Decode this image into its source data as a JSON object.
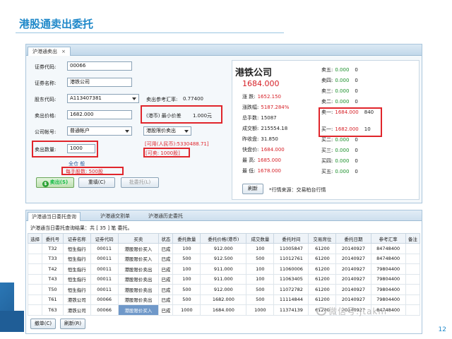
{
  "slide": {
    "title": "港股通卖出委托",
    "page": "12"
  },
  "top_tab": {
    "label": "沪港通卖出",
    "close": "×"
  },
  "form": {
    "code_label": "证券代码:",
    "code_value": "00066",
    "name_label": "证券名称:",
    "name_value": "港铁公司",
    "account_label": "股东代码:",
    "account_value": "A113407381",
    "rate_label": "卖出参考汇率:",
    "rate_value": "0.77400",
    "price_label": "卖出价格:",
    "price_value": "1682.000",
    "price_diff_label": "(港币) 最小价差",
    "price_diff_value": "1.000元",
    "mode_label": "交易方式:",
    "mode_value": "港股限价卖出",
    "company_label": "公司帐号:",
    "company_value": "普通帐户",
    "available_funds": "[可用(人民币):5330488.71]",
    "qty_label": "卖出数量:",
    "qty_value": "1000",
    "sellable": "[可卖: 1000股]",
    "lot_note": "全仓 般",
    "lot_size": "每手股数: 500股",
    "sell_button": "卖出(S)",
    "clear_button": "重填(C)",
    "batch_button": "批委托(L)"
  },
  "quote": {
    "name": "港铁公司",
    "price": "1684.000",
    "left_rows": [
      {
        "label": "涨  跌:",
        "value": "1652.150"
      },
      {
        "label": "涨跌幅:",
        "value": "5187.284%"
      },
      {
        "label": "总手数:",
        "value": "15087"
      },
      {
        "label": "成交额:",
        "value": "215554.18"
      },
      {
        "label": "昨收盘:",
        "value": "31.850"
      },
      {
        "label": "快盘价:",
        "value": "1684.000"
      },
      {
        "label": "最  高:",
        "value": "1685.000"
      },
      {
        "label": "最  低:",
        "value": "1678.000"
      }
    ],
    "sell_rows": [
      {
        "label": "卖五:",
        "price": "0.000",
        "vol": "0"
      },
      {
        "label": "卖四:",
        "price": "0.000",
        "vol": "0"
      },
      {
        "label": "卖三:",
        "price": "0.000",
        "vol": "0"
      },
      {
        "label": "卖二:",
        "price": "0.000",
        "vol": "0"
      },
      {
        "label": "卖一:",
        "price": "1684.000",
        "vol": "840"
      }
    ],
    "buy_rows": [
      {
        "label": "买一:",
        "price": "1682.000",
        "vol": "10"
      },
      {
        "label": "买二:",
        "price": "0.000",
        "vol": "0"
      },
      {
        "label": "买三:",
        "price": "0.000",
        "vol": "0"
      },
      {
        "label": "买四:",
        "price": "0.000",
        "vol": "0"
      },
      {
        "label": "买五:",
        "price": "0.000",
        "vol": "0"
      }
    ],
    "refresh_button": "刷新",
    "source": "*行情来源：交易柏台行情"
  },
  "lower": {
    "tabs": [
      "沪港通当日委托查询",
      "沪港通交割单",
      "沪港通历史委托"
    ],
    "query_info": "沪港通当日委托查询结果：共 [ 35 ] 笔 委托。",
    "columns": [
      "选择",
      "委托号",
      "证券名称",
      "证券代码",
      "买卖",
      "状态",
      "委托数量",
      "委托价格(港币)",
      "成交数量",
      "委托时间",
      "交易席位",
      "委托日期",
      "参考汇率",
      "备注"
    ],
    "rows": [
      [
        "",
        "T32",
        "恒生指行",
        "00011",
        "港股限价买入",
        "已成",
        "100",
        "912.000",
        "100",
        "11005847",
        "61200",
        "20140927",
        "84748400",
        ""
      ],
      [
        "",
        "T33",
        "恒生指行",
        "00011",
        "港股限价买入",
        "已成",
        "500",
        "912.500",
        "500",
        "11012761",
        "61200",
        "20140927",
        "84748400",
        ""
      ],
      [
        "",
        "T42",
        "恒生指行",
        "00011",
        "港股限价卖出",
        "已成",
        "100",
        "911.000",
        "100",
        "11060006",
        "61200",
        "20140927",
        "79804400",
        ""
      ],
      [
        "",
        "T43",
        "恒生指行",
        "00011",
        "港股限价卖出",
        "已成",
        "100",
        "911.000",
        "100",
        "11063405",
        "61200",
        "20140927",
        "79804400",
        ""
      ],
      [
        "",
        "T50",
        "恒生指行",
        "00011",
        "港股限价卖出",
        "已成",
        "500",
        "912.000",
        "500",
        "11072782",
        "61200",
        "20140927",
        "79804400",
        ""
      ],
      [
        "",
        "T61",
        "港铁公司",
        "00066",
        "港股限价卖出",
        "已成",
        "500",
        "1682.000",
        "500",
        "11114844",
        "61200",
        "20140927",
        "79804400",
        ""
      ],
      [
        "",
        "T63",
        "港铁公司",
        "00066",
        "港股限价买入",
        "已成",
        "1000",
        "1684.000",
        "1000",
        "11374139",
        "61200",
        "20140927",
        "84748400",
        ""
      ]
    ],
    "batch_sell_button": "撤单(C)",
    "refresh_button": "刷新(R)"
  },
  "watermark": "微信号:jtakm"
}
